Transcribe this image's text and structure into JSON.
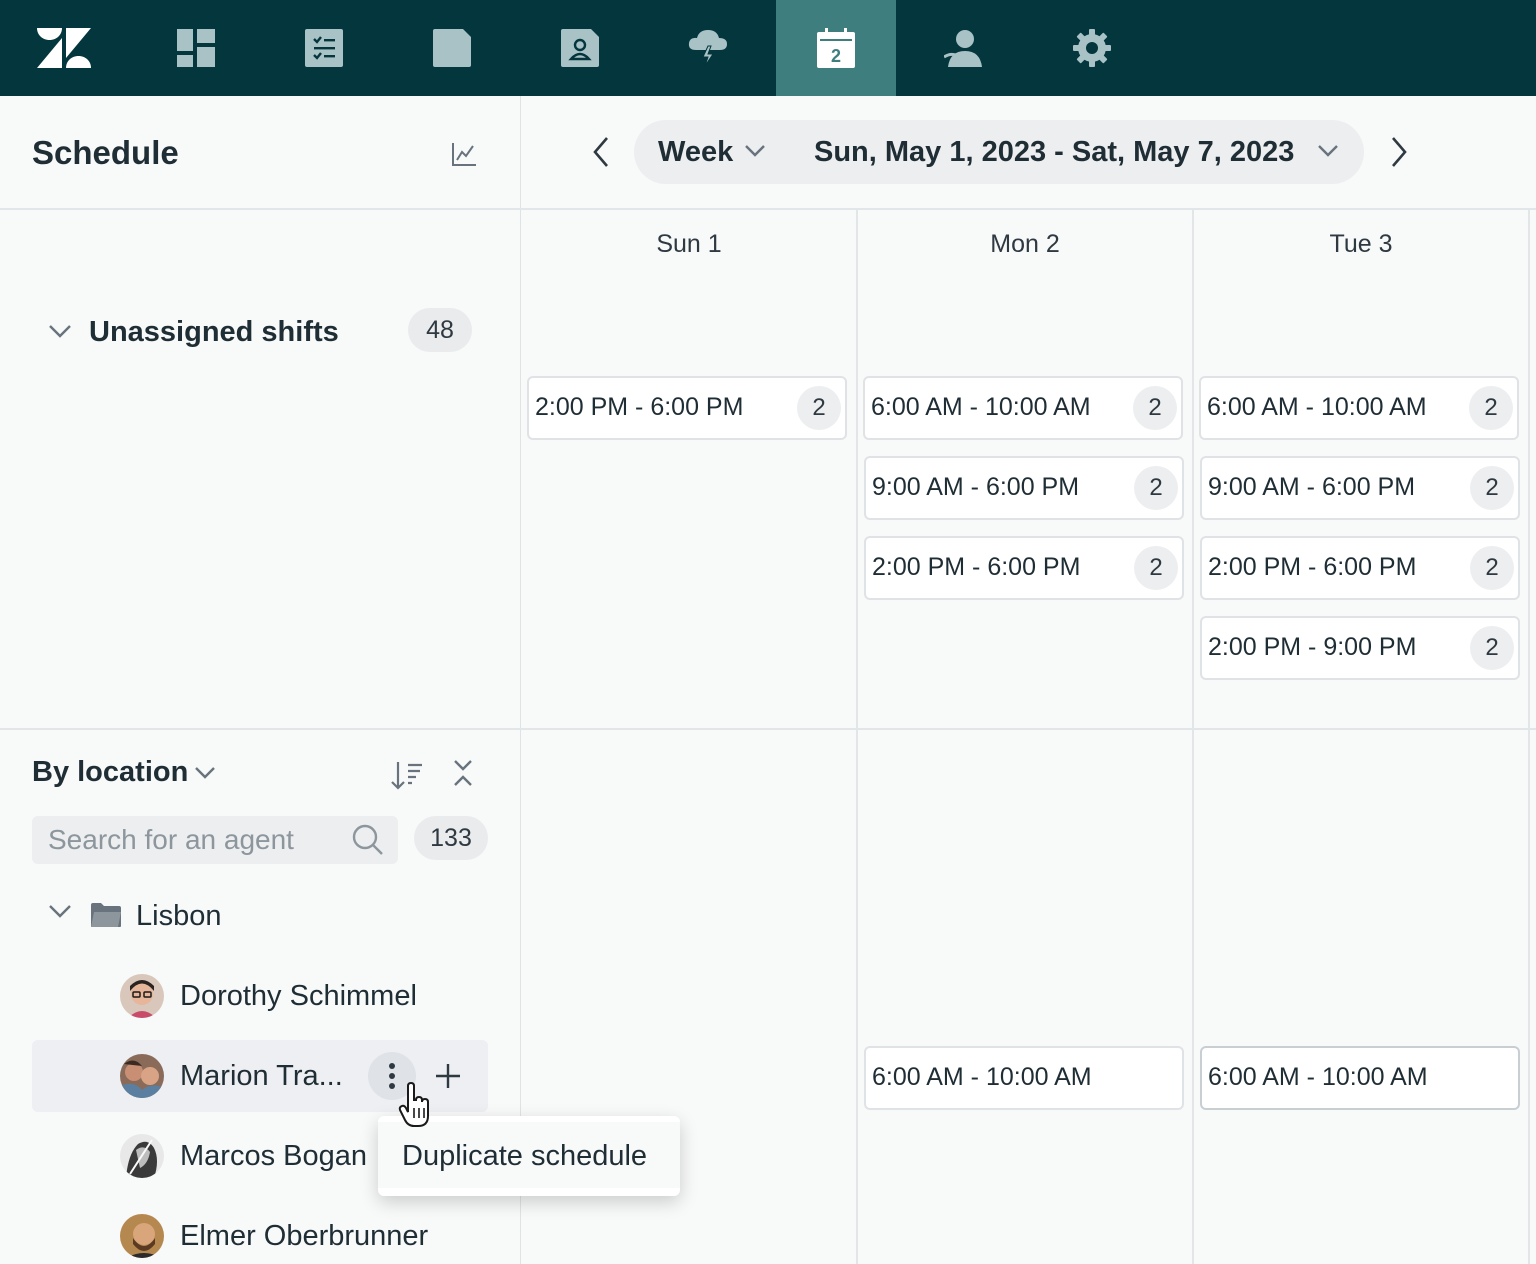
{
  "nav": {
    "items": [
      {
        "name": "zendesk-logo",
        "active": false
      },
      {
        "name": "dashboard-icon",
        "active": false
      },
      {
        "name": "task-list-icon",
        "active": false
      },
      {
        "name": "folder-icon",
        "active": false
      },
      {
        "name": "contact-card-icon",
        "active": false
      },
      {
        "name": "storm-cloud-icon",
        "active": false
      },
      {
        "name": "calendar-icon",
        "active": true
      },
      {
        "name": "agents-icon",
        "active": false
      },
      {
        "name": "settings-gear-icon",
        "active": false
      }
    ],
    "calendar_day": "2",
    "colors": {
      "bar": "#03363d",
      "active": "#3f7e7e",
      "icon": "#a9c2c5",
      "icon_active": "#ffffff"
    }
  },
  "left": {
    "title": "Schedule",
    "unassigned": {
      "label": "Unassigned shifts",
      "count": "48"
    },
    "group_by": {
      "label": "By location"
    },
    "search": {
      "placeholder": "Search for an agent",
      "count": "133"
    },
    "location": {
      "label": "Lisbon"
    },
    "agents": [
      {
        "name": "Dorothy Schimmel"
      },
      {
        "name": "Marion Tra..."
      },
      {
        "name": "Marcos Bogan"
      },
      {
        "name": "Elmer Oberbrunner"
      }
    ],
    "context_menu": {
      "item": "Duplicate schedule"
    }
  },
  "header": {
    "view": "Week",
    "range": "Sun, May 1, 2023 - Sat, May 7, 2023"
  },
  "days": [
    "Sun 1",
    "Mon 2",
    "Tue 3"
  ],
  "unassigned_shifts": [
    [
      {
        "time": "2:00 PM - 6:00 PM",
        "count": "2"
      }
    ],
    [
      {
        "time": "6:00 AM - 10:00 AM",
        "count": "2"
      },
      {
        "time": "9:00 AM - 6:00 PM",
        "count": "2"
      },
      {
        "time": "2:00 PM - 6:00 PM",
        "count": "2"
      }
    ],
    [
      {
        "time": "6:00 AM - 10:00 AM",
        "count": "2"
      },
      {
        "time": "9:00 AM - 6:00 PM",
        "count": "2"
      },
      {
        "time": "2:00 PM - 6:00 PM",
        "count": "2"
      },
      {
        "time": "2:00 PM - 9:00 PM",
        "count": "2"
      }
    ]
  ],
  "agent_shifts": {
    "marion": {
      "mon": "6:00 AM - 10:00 AM",
      "tue": "6:00 AM - 10:00 AM"
    }
  }
}
